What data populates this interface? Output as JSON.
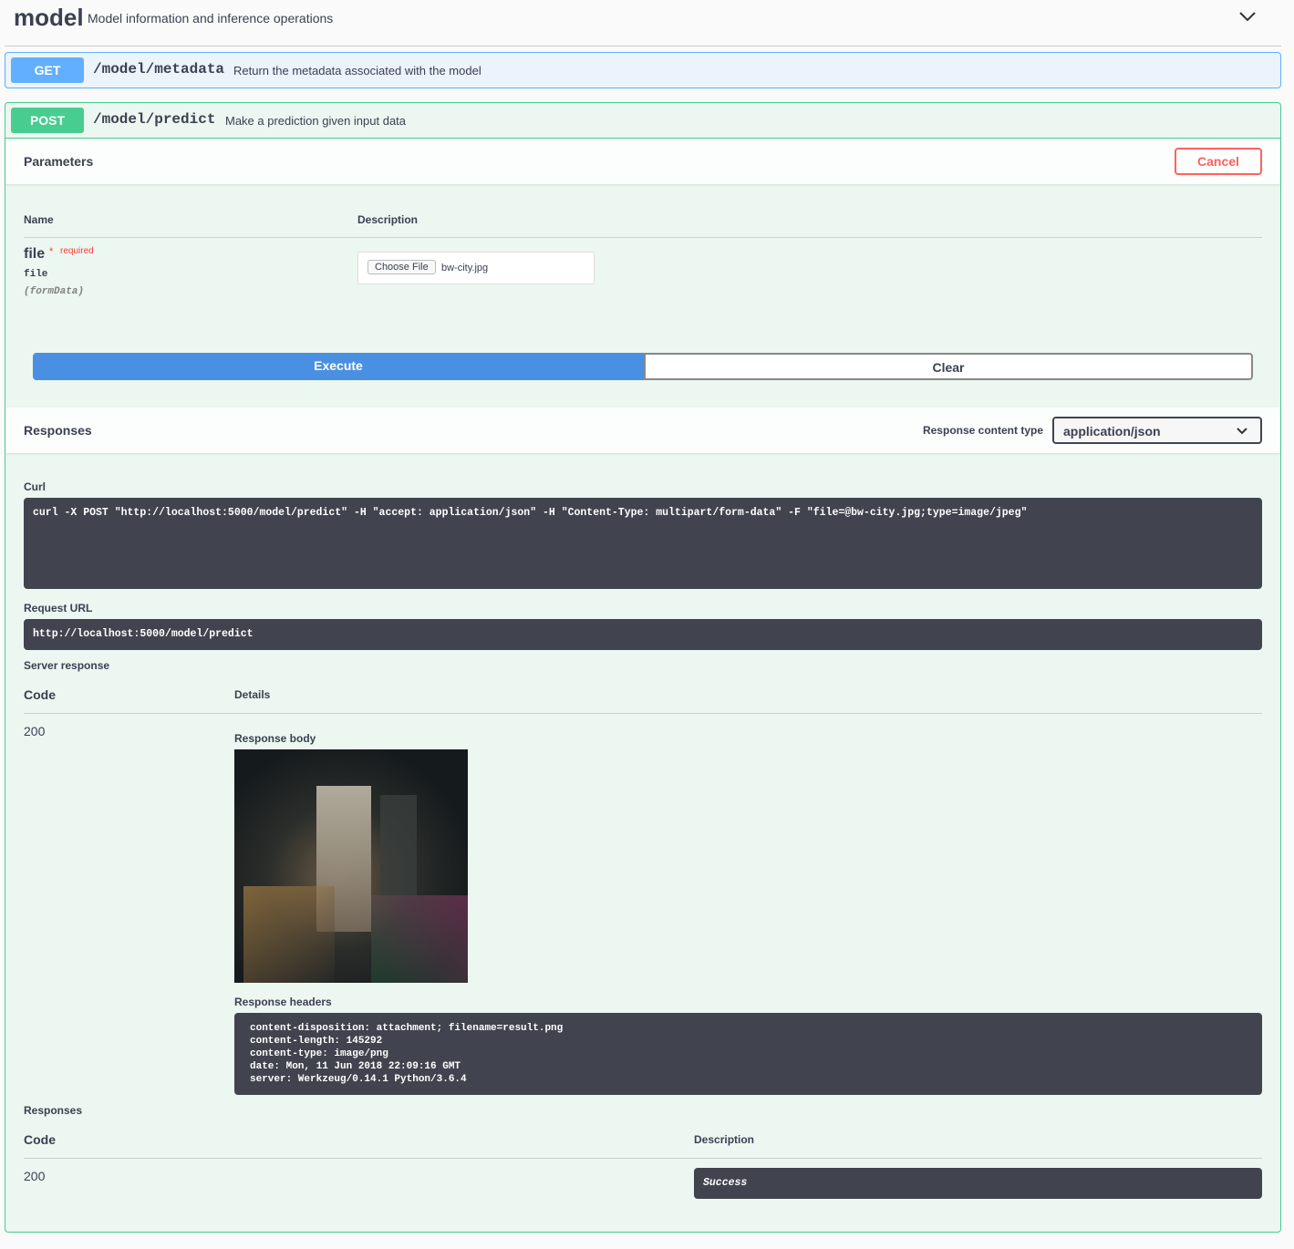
{
  "tag": {
    "title": "model",
    "description": "Model information and inference operations"
  },
  "get_op": {
    "method": "GET",
    "path": "/model/metadata",
    "summary": "Return the metadata associated with the model"
  },
  "post_op": {
    "method": "POST",
    "path": "/model/predict",
    "summary": "Make a prediction given input data",
    "parameters_title": "Parameters",
    "cancel_label": "Cancel",
    "col_name": "Name",
    "col_description": "Description",
    "param": {
      "name": "file",
      "required_star": "*",
      "required_label": "required",
      "type": "file",
      "in": "(formData)",
      "choose_file_label": "Choose File",
      "file_value": "bw-city.jpg"
    },
    "execute_label": "Execute",
    "clear_label": "Clear",
    "responses_title": "Responses",
    "content_type_label": "Response content type",
    "content_type_value": "application/json",
    "curl_label": "Curl",
    "curl": "curl -X POST \"http://localhost:5000/model/predict\" -H \"accept: application/json\" -H \"Content-Type: multipart/form-data\" -F \"file=@bw-city.jpg;type=image/jpeg\"",
    "request_url_label": "Request URL",
    "request_url": "http://localhost:5000/model/predict",
    "server_response_label": "Server response",
    "code_label": "Code",
    "details_label": "Details",
    "server_code": "200",
    "response_body_label": "Response body",
    "response_headers_label": "Response headers",
    "headers": [
      "content-disposition: attachment; filename=result.png",
      "content-length: 145292",
      "content-type: image/png",
      "date: Mon, 11 Jun 2018 22:09:16 GMT",
      "server: Werkzeug/0.14.1 Python/3.6.4"
    ],
    "responses_label": "Responses",
    "resp_code_label": "Code",
    "resp_desc_label": "Description",
    "resp_code": "200",
    "resp_desc": "Success"
  },
  "colors": {
    "get": "#61affe",
    "post": "#49cc90",
    "execute": "#4990e2",
    "cancel": "#ff6060"
  }
}
